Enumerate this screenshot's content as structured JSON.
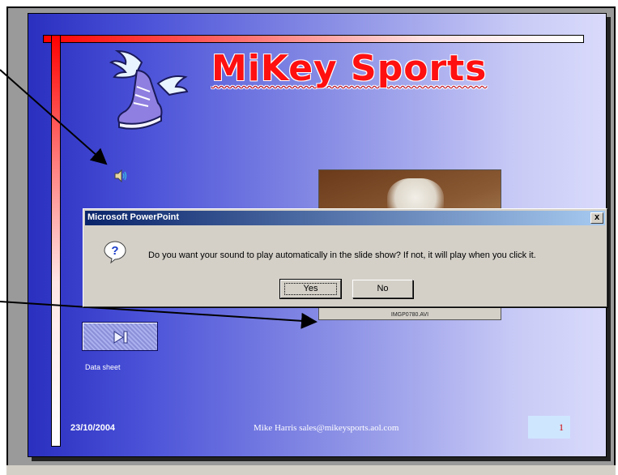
{
  "slide": {
    "title": "MiKey Sports",
    "video_label": "IMGP0780.AVI",
    "datasheet_label": "Data sheet",
    "date": "23/10/2004",
    "footer_text": "Mike Harris  sales@mikeysports.aol.com",
    "page_number": "1",
    "icons": {
      "logo": "winged-shoe-icon",
      "sound": "speaker-icon",
      "action": "play-next-icon"
    }
  },
  "dialog": {
    "title": "Microsoft PowerPoint",
    "message": "Do you want your sound to play automatically in the slide show? If not, it will play when you click it.",
    "yes_label": "Yes",
    "no_label": "No",
    "close_label": "x",
    "icon": "question-icon"
  },
  "colors": {
    "title_red": "#ff1010",
    "dialog_title_start": "#0a246a",
    "dialog_title_end": "#a6caf0",
    "slide_blue": "#2a2fbf"
  }
}
